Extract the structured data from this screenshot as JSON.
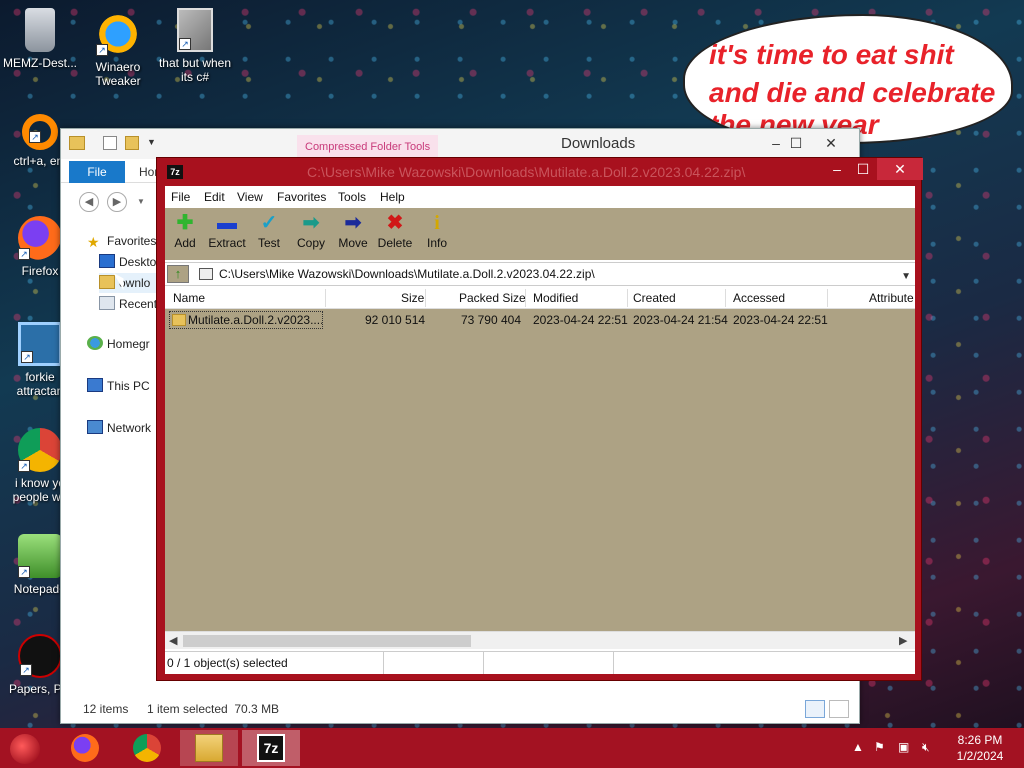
{
  "desktop": {
    "icons": [
      {
        "label": "MEMZ-Dest..."
      },
      {
        "label": "Winaero\nTweaker"
      },
      {
        "label": "that but when\nits c#"
      },
      {
        "label": "ctrl+a, ent"
      },
      {
        "label": "Firefox"
      },
      {
        "label": "forkie\nattractan"
      },
      {
        "label": "i know yo\npeople we"
      },
      {
        "label": "Notepad+"
      },
      {
        "label": "Papers, Ple"
      }
    ],
    "bubble_lines": [
      "it's time to eat shit",
      "and die and celebrate",
      "the new year"
    ]
  },
  "explorer": {
    "tools_tab": "Compressed Folder Tools",
    "title": "Downloads",
    "file_tab": "File",
    "home_tab": "Hor",
    "tree": [
      {
        "label": "Favorites",
        "icon": "star-icon"
      },
      {
        "label": "Deskto",
        "icon": "desktop-icon"
      },
      {
        "label": "ownlo",
        "icon": "folder-icon"
      },
      {
        "label": "Recent",
        "icon": "recent-icon"
      },
      {
        "label": "Homegr",
        "icon": "homegroup-icon"
      },
      {
        "label": "This PC",
        "icon": "computer-icon"
      },
      {
        "label": "Network",
        "icon": "network-icon"
      }
    ],
    "status": {
      "items": "12 items",
      "selected": "1 item selected  70.3 MB"
    }
  },
  "zip": {
    "title": "C:\\Users\\Mike Wazowski\\Downloads\\Mutilate.a.Doll.2.v2023.04.22.zip\\",
    "menu": [
      "File",
      "Edit",
      "View",
      "Favorites",
      "Tools",
      "Help"
    ],
    "toolbar": [
      {
        "label": "Add",
        "icon": "plus-icon",
        "color": "#2fb52f"
      },
      {
        "label": "Extract",
        "icon": "minus-icon",
        "color": "#1a3fcf"
      },
      {
        "label": "Test",
        "icon": "check-icon",
        "color": "#1aa0c8"
      },
      {
        "label": "Copy",
        "icon": "copy-arrow-icon",
        "color": "#1a9a8a"
      },
      {
        "label": "Move",
        "icon": "move-arrow-icon",
        "color": "#1a2a9a"
      },
      {
        "label": "Delete",
        "icon": "delete-x-icon",
        "color": "#d01818"
      },
      {
        "label": "Info",
        "icon": "info-icon",
        "color": "#d4a800"
      }
    ],
    "address": "C:\\Users\\Mike Wazowski\\Downloads\\Mutilate.a.Doll.2.v2023.04.22.zip\\",
    "columns": [
      "Name",
      "Size",
      "Packed Size",
      "Modified",
      "Created",
      "Accessed",
      "Attribute"
    ],
    "rows": [
      {
        "name": "Mutilate.a.Doll.2.v2023....",
        "size": "92 010 514",
        "packed": "73 790 404",
        "modified": "2023-04-24 22:51",
        "created": "2023-04-24 21:54",
        "accessed": "2023-04-24 22:51"
      }
    ],
    "status": "0 / 1 object(s) selected"
  },
  "taskbar": {
    "time": "8:26 PM",
    "date": "1/2/2024",
    "app_7z": "7z"
  },
  "colors": {
    "taskbar": "#a31222",
    "zip_frame": "#a8111e",
    "zip_toolbar": "#ada284",
    "bubble_text": "#e8222a"
  }
}
